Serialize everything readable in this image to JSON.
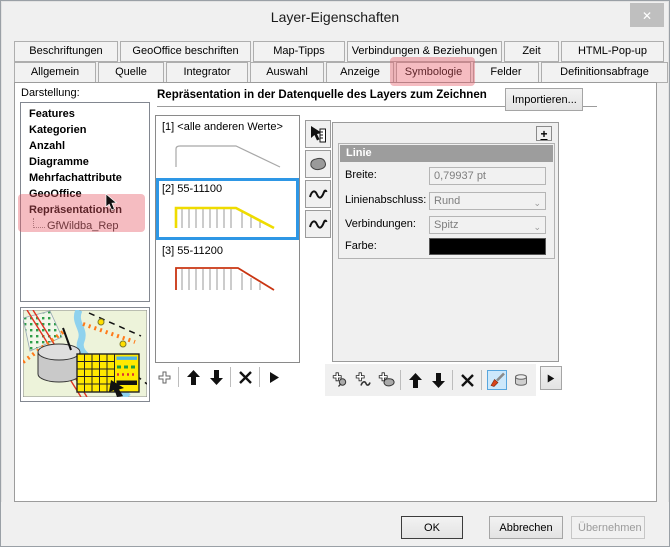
{
  "window": {
    "title": "Layer-Eigenschaften",
    "close_icon": "✕"
  },
  "tabs": {
    "row1": [
      "Beschriftungen",
      "GeoOffice beschriften",
      "Map-Tipps",
      "Verbindungen & Beziehungen",
      "Zeit",
      "HTML-Pop-up"
    ],
    "row2": [
      "Allgemein",
      "Quelle",
      "Integrator",
      "Auswahl",
      "Anzeige",
      "Symbologie",
      "Felder",
      "Definitionsabfrage"
    ],
    "active_tab": "Symbologie"
  },
  "sidebar": {
    "heading": "Darstellung:",
    "items": [
      "Features",
      "Kategorien",
      "Anzahl",
      "Diagramme",
      "Mehrfachattribute",
      "GeoOffice",
      "Repräsentationen"
    ],
    "child": "GfWildba_Rep"
  },
  "representation": {
    "header": "Repräsentation in der Datenquelle des Layers zum Zeichnen",
    "import_button": "Importieren...",
    "rules": [
      {
        "label": "[1] <alle anderen Werte>",
        "stroke": "#a8a8a8",
        "selected": false
      },
      {
        "label": "[2] 55-11100",
        "stroke": "#efdc00",
        "selected": true
      },
      {
        "label": "[3] 55-11200",
        "stroke": "#c93512",
        "selected": false
      }
    ]
  },
  "properties": {
    "add_button": "+",
    "section": "Linie",
    "breite_label": "Breite:",
    "breite_value": "0,79937 pt",
    "abschluss_label": "Linienabschluss:",
    "abschluss_value": "Rund",
    "verbindungen_label": "Verbindungen:",
    "verbindungen_value": "Spitz",
    "farbe_label": "Farbe:",
    "farbe_value": "#000000"
  },
  "footer": {
    "ok": "OK",
    "cancel": "Abbrechen",
    "apply": "Übernehmen"
  },
  "colors": {
    "annotation_pink": "#f2b4ba",
    "selection_blue": "#2e97e5",
    "section_header_gray": "#9d9d9d"
  },
  "icons": {
    "left_toolbar": [
      "new-rule-icon",
      "move-up-icon",
      "move-down-icon",
      "delete-icon",
      "more-icon"
    ],
    "right_toolbar": [
      "add-marker-layer-icon",
      "add-stroke-layer-icon",
      "add-fill-layer-icon",
      "move-up-icon",
      "move-down-icon",
      "delete-icon",
      "paintbrush-icon",
      "eraser-cylinder-icon",
      "more-icon"
    ],
    "vertical_tabs": [
      "selector-ruler-icon",
      "fill-blob-icon",
      "stroke-squiggle-icon",
      "stroke-squiggle-icon"
    ]
  }
}
